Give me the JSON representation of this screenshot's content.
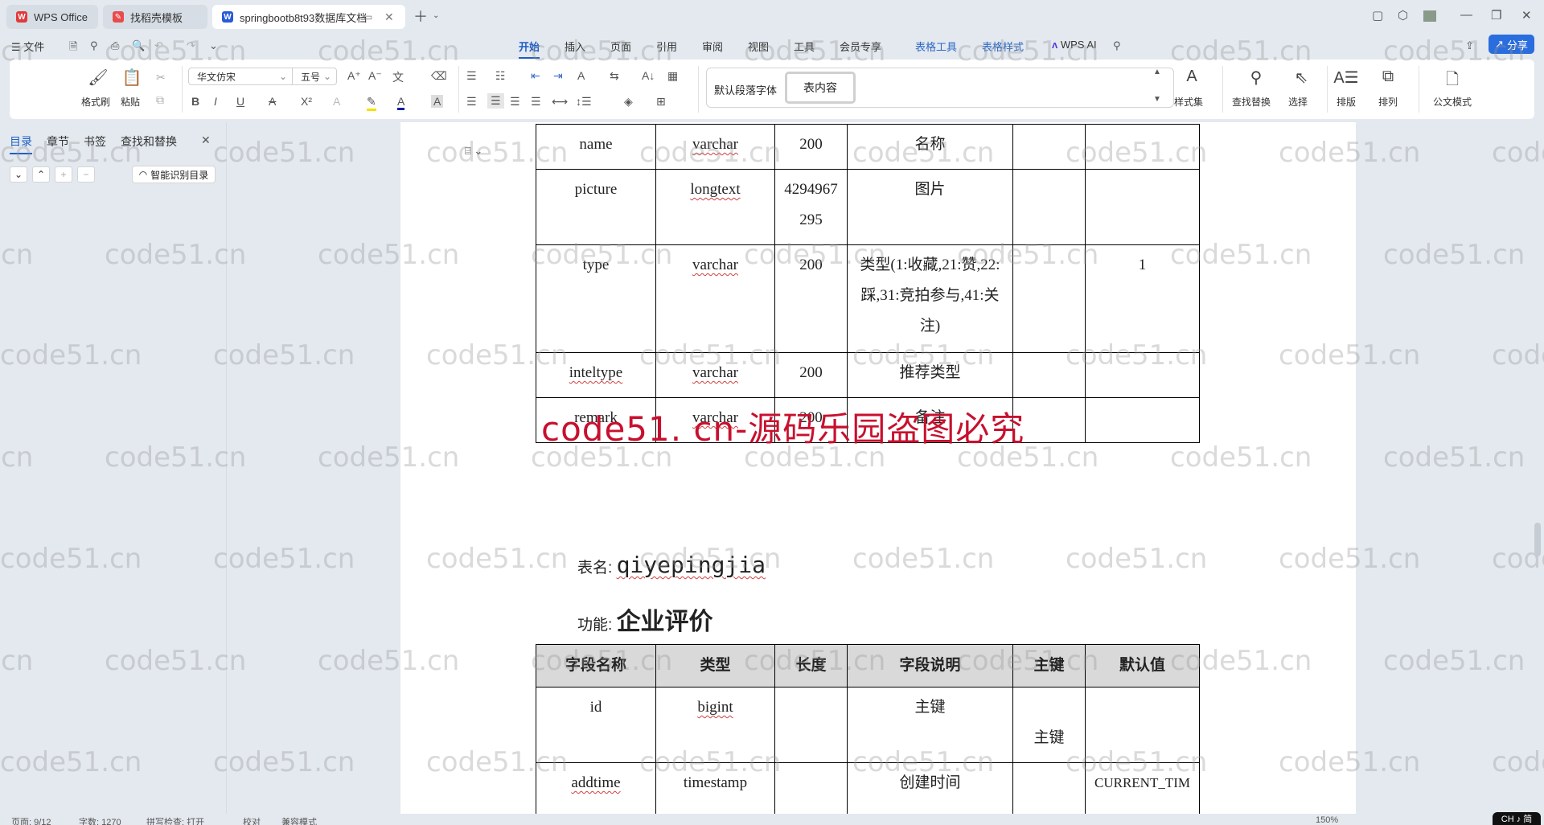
{
  "tabs": [
    {
      "label": "WPS Office",
      "icon": "wps-logo-icon"
    },
    {
      "label": "找稻壳模板",
      "icon": "docer-icon"
    },
    {
      "label": "springbootb8t93数据库文档",
      "icon": "word-doc-icon",
      "active": true
    }
  ],
  "menu": {
    "file": "文件",
    "items": [
      "开始",
      "插入",
      "页面",
      "引用",
      "审阅",
      "视图",
      "工具",
      "会员专享"
    ],
    "active": "开始",
    "context_items": [
      "表格工具",
      "表格样式"
    ],
    "wps_ai": "WPS AI",
    "share": "分享"
  },
  "ribbon": {
    "format_painter": "格式刷",
    "paste": "粘贴",
    "font_name": "华文仿宋",
    "font_size": "五号",
    "styles": [
      "默认段落字体",
      "表内容"
    ],
    "selected_style": "表内容",
    "style_set": "样式集",
    "find_replace": "查找替换",
    "select": "选择",
    "layout": "排版",
    "arrange": "排列",
    "official_mode": "公文模式"
  },
  "nav_pane": {
    "tabs": [
      "目录",
      "章节",
      "书签",
      "查找和替换"
    ],
    "active": "目录",
    "smart_toc": "智能识别目录"
  },
  "document": {
    "table1_rows": [
      {
        "name": "name",
        "type": "varchar",
        "length": "200",
        "desc": "名称",
        "pk": "",
        "default": ""
      },
      {
        "name": "picture",
        "type": "longtext",
        "length": "4294967295",
        "desc": "图片",
        "pk": "",
        "default": ""
      },
      {
        "name": "type",
        "type": "varchar",
        "length": "200",
        "desc": "类型(1:收藏,21:赞,22:踩,31:竞拍参与,41:关注)",
        "pk": "",
        "default": "1"
      },
      {
        "name": "inteltype",
        "type": "varchar",
        "length": "200",
        "desc": "推荐类型",
        "pk": "",
        "default": ""
      },
      {
        "name": "remark",
        "type": "varchar",
        "length": "200",
        "desc": "备注",
        "pk": "",
        "default": ""
      }
    ],
    "red_watermark": "code51. cn-源码乐园盗图必究",
    "table_name_label": "表名:",
    "table_name": "qiyepingjia",
    "function_label": "功能:",
    "function": "企业评价",
    "table2_headers": [
      "字段名称",
      "类型",
      "长度",
      "字段说明",
      "主键",
      "默认值"
    ],
    "table2_rows": [
      {
        "name": "id",
        "type": "bigint",
        "length": "",
        "desc": "主键",
        "pk": "主键",
        "default": ""
      },
      {
        "name": "addtime",
        "type": "timestamp",
        "length": "",
        "desc": "创建时间",
        "pk": "",
        "default": "CURRENT_TIM"
      }
    ]
  },
  "watermark_text": "code51.cn",
  "status": {
    "page": "页面: 9/12",
    "words": "字数: 1270",
    "spell": "拼写检查: 打开",
    "proof": "校对",
    "compat": "兼容模式",
    "zoom": "150%",
    "ime": "CH ♪ 简"
  }
}
